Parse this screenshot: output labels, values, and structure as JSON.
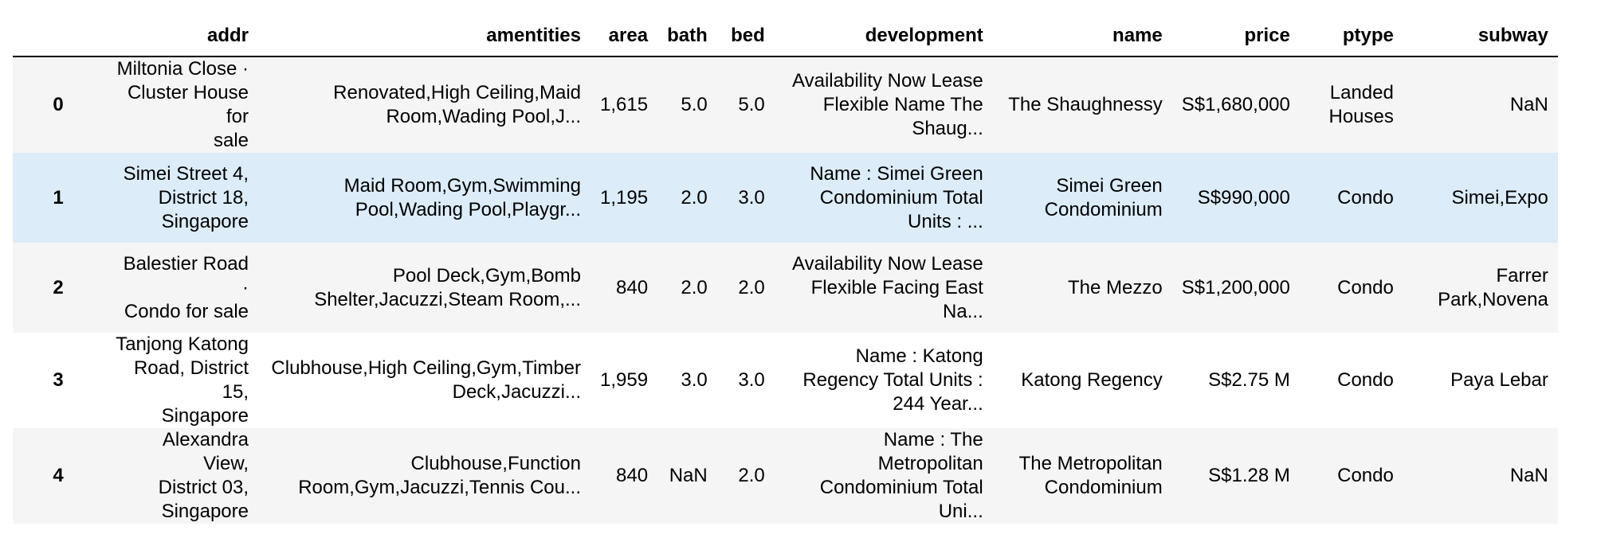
{
  "table": {
    "columns": [
      "addr",
      "amentities",
      "area",
      "bath",
      "bed",
      "development",
      "name",
      "price",
      "ptype",
      "subway"
    ],
    "rows": [
      {
        "index": "0",
        "addr": [
          "Miltonia Close ·",
          "Cluster House for",
          "sale"
        ],
        "amentities": [
          "Renovated,High Ceiling,Maid",
          "Room,Wading Pool,J..."
        ],
        "area": "1,615",
        "bath": "5.0",
        "bed": "5.0",
        "development": [
          "Availability Now Lease",
          "Flexible Name The",
          "Shaug..."
        ],
        "name": [
          "The Shaughnessy"
        ],
        "price": "S$1,680,000",
        "ptype": [
          "Landed",
          "Houses"
        ],
        "subway": [
          "NaN"
        ]
      },
      {
        "index": "1",
        "addr": [
          "Simei Street 4,",
          "District 18,",
          "Singapore"
        ],
        "amentities": [
          "Maid Room,Gym,Swimming",
          "Pool,Wading Pool,Playgr..."
        ],
        "area": "1,195",
        "bath": "2.0",
        "bed": "3.0",
        "development": [
          "Name : Simei Green",
          "Condominium Total",
          "Units : ..."
        ],
        "name": [
          "Simei Green",
          "Condominium"
        ],
        "price": "S$990,000",
        "ptype": [
          "Condo"
        ],
        "subway": [
          "Simei,Expo"
        ]
      },
      {
        "index": "2",
        "addr": [
          "Balestier Road ·",
          "Condo for sale"
        ],
        "amentities": [
          "Pool Deck,Gym,Bomb",
          "Shelter,Jacuzzi,Steam Room,..."
        ],
        "area": "840",
        "bath": "2.0",
        "bed": "2.0",
        "development": [
          "Availability Now Lease",
          "Flexible Facing East",
          "Na..."
        ],
        "name": [
          "The Mezzo"
        ],
        "price": "S$1,200,000",
        "ptype": [
          "Condo"
        ],
        "subway": [
          "Farrer",
          "Park,Novena"
        ]
      },
      {
        "index": "3",
        "addr": [
          "Tanjong Katong",
          "Road, District 15,",
          "Singapore"
        ],
        "amentities": [
          "Clubhouse,High Ceiling,Gym,Timber",
          "Deck,Jacuzzi..."
        ],
        "area": "1,959",
        "bath": "3.0",
        "bed": "3.0",
        "development": [
          "Name : Katong",
          "Regency Total Units :",
          "244 Year..."
        ],
        "name": [
          "Katong Regency"
        ],
        "price": "S$2.75 M",
        "ptype": [
          "Condo"
        ],
        "subway": [
          "Paya Lebar"
        ]
      },
      {
        "index": "4",
        "addr": [
          "Alexandra View,",
          "District 03,",
          "Singapore"
        ],
        "amentities": [
          "Clubhouse,Function",
          "Room,Gym,Jacuzzi,Tennis Cou..."
        ],
        "area": "840",
        "bath": "NaN",
        "bed": "2.0",
        "development": [
          "Name : The",
          "Metropolitan",
          "Condominium Total",
          "Uni..."
        ],
        "name": [
          "The Metropolitan",
          "Condominium"
        ],
        "price": "S$1.28 M",
        "ptype": [
          "Condo"
        ],
        "subway": [
          "NaN"
        ]
      }
    ],
    "highlighted_row": 1,
    "colors": {
      "row_odd": "#f5f5f5",
      "row_even": "#ffffff",
      "row_hover": "#dcecf9",
      "header_rule": "#000000"
    }
  }
}
